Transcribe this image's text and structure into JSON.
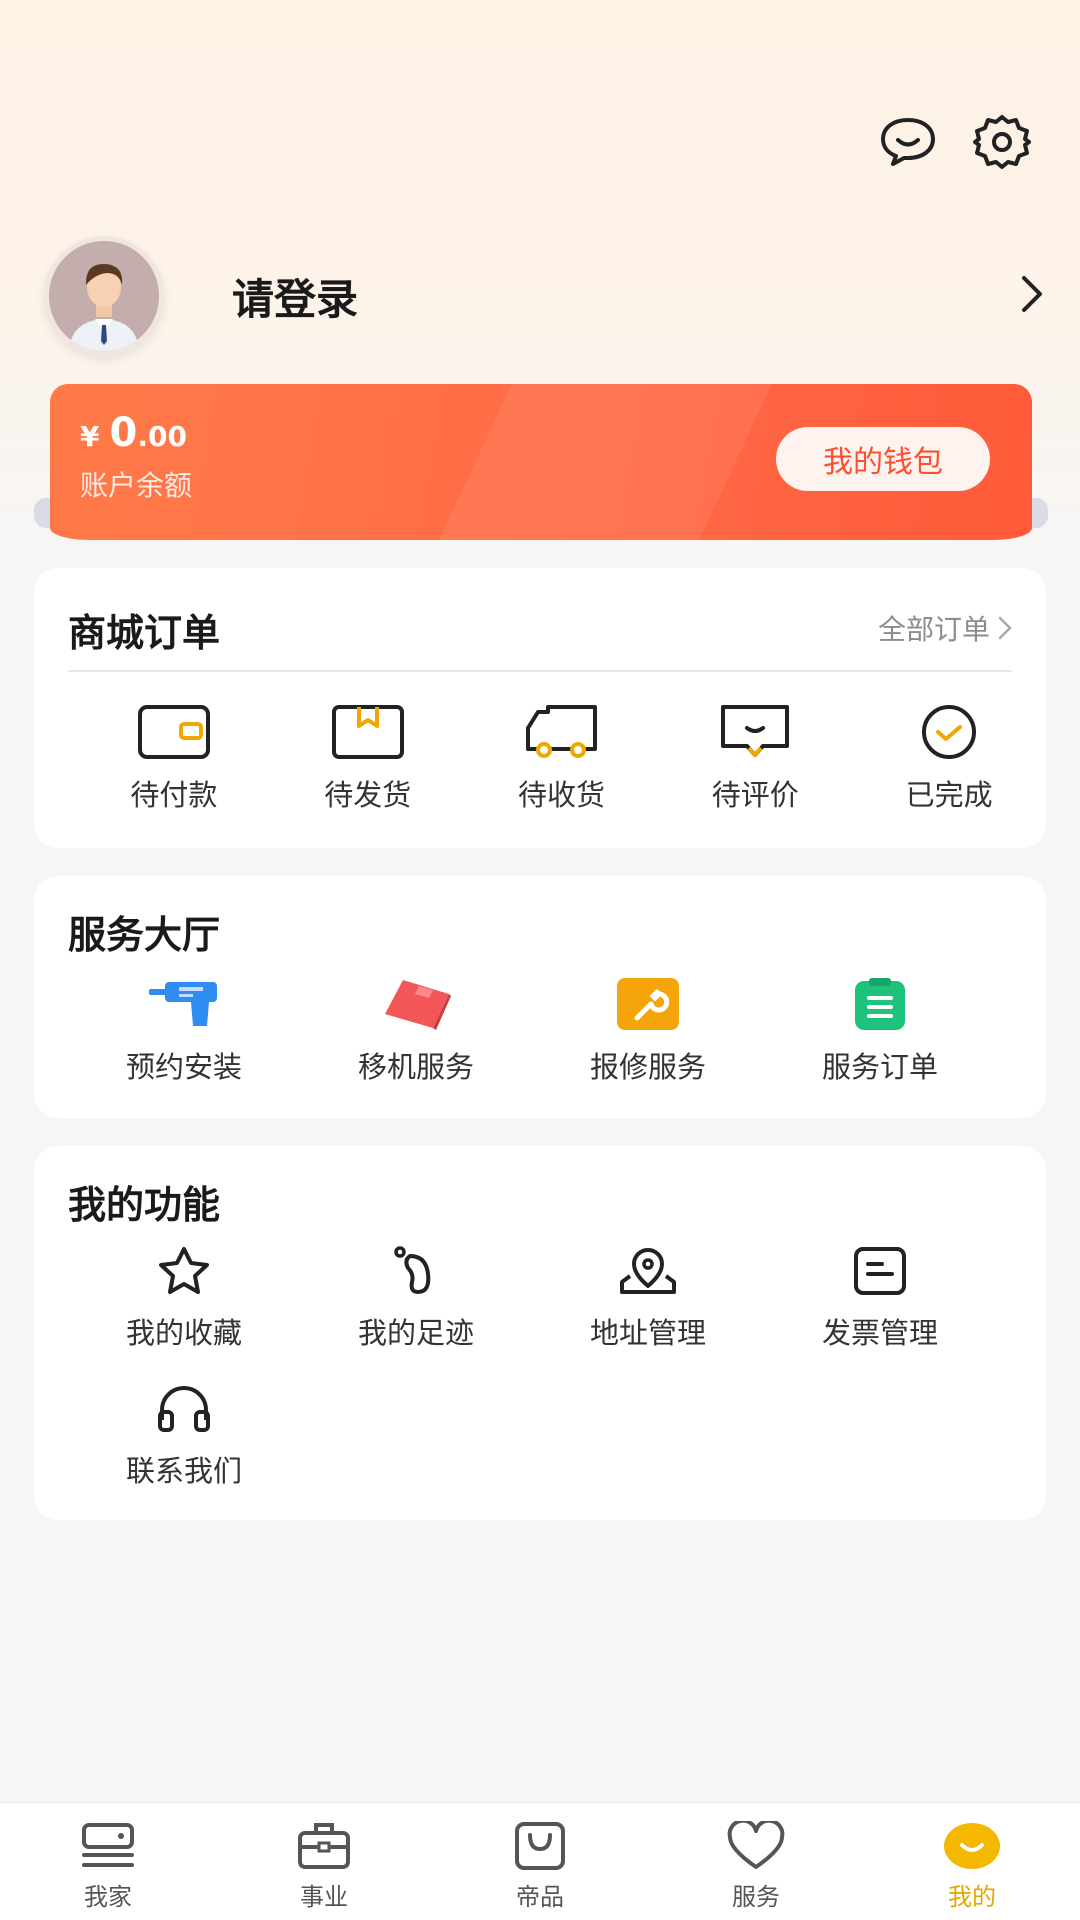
{
  "header": {
    "message_icon": "message-chat-icon",
    "settings_icon": "gear-icon"
  },
  "profile": {
    "login_text": "请登录"
  },
  "wallet": {
    "currency": "¥",
    "amount_int": "0",
    "amount_dec": ".00",
    "label": "账户余额",
    "button": "我的钱包",
    "color": "#ff6b47"
  },
  "orders": {
    "title": "商城订单",
    "all_label": "全部订单",
    "items": [
      {
        "label": "待付款",
        "icon": "wallet-icon"
      },
      {
        "label": "待发货",
        "icon": "box-icon"
      },
      {
        "label": "待收货",
        "icon": "truck-icon"
      },
      {
        "label": "待评价",
        "icon": "comment-icon"
      },
      {
        "label": "已完成",
        "icon": "check-circle-icon"
      }
    ]
  },
  "service": {
    "title": "服务大厅",
    "items": [
      {
        "label": "预约安装",
        "icon": "drill-icon",
        "color": "#2f8cf0"
      },
      {
        "label": "移机服务",
        "icon": "move-box-icon",
        "color": "#f25656"
      },
      {
        "label": "报修服务",
        "icon": "wrench-icon",
        "color": "#f5a50a"
      },
      {
        "label": "服务订单",
        "icon": "clipboard-icon",
        "color": "#1ec27a"
      }
    ]
  },
  "functions": {
    "title": "我的功能",
    "items": [
      {
        "label": "我的收藏",
        "icon": "star-icon"
      },
      {
        "label": "我的足迹",
        "icon": "footprint-icon"
      },
      {
        "label": "地址管理",
        "icon": "location-icon"
      },
      {
        "label": "发票管理",
        "icon": "invoice-icon"
      },
      {
        "label": "联系我们",
        "icon": "headset-icon"
      }
    ]
  },
  "tabbar": {
    "active_color": "#e0a800",
    "tabs": [
      {
        "label": "我家",
        "icon": "home-device-icon"
      },
      {
        "label": "事业",
        "icon": "briefcase-icon"
      },
      {
        "label": "帝品",
        "icon": "shopping-bag-icon"
      },
      {
        "label": "服务",
        "icon": "heart-icon"
      },
      {
        "label": "我的",
        "icon": "smile-face-icon",
        "active": true
      }
    ]
  }
}
